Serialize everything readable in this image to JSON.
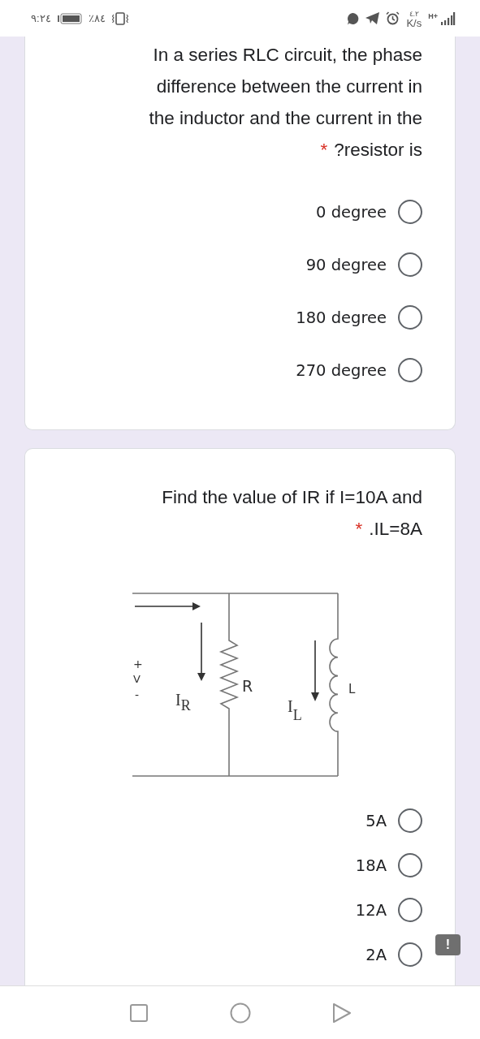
{
  "status_bar": {
    "time": "٩:٢٤",
    "battery": "٪٨٤",
    "speed_value": "٤.٢",
    "speed_unit": "K/s",
    "network": "H+"
  },
  "questions": [
    {
      "text_lines": [
        "In a series RLC circuit, the phase",
        "difference between the current in",
        "the inductor and the current in the",
        "?resistor is"
      ],
      "required": true,
      "required_mark": "*",
      "options": [
        {
          "label": "0 degree",
          "selected": false
        },
        {
          "label": "90 degree",
          "selected": false
        },
        {
          "label": "180 degree",
          "selected": false
        },
        {
          "label": "270 degree",
          "selected": false
        }
      ]
    },
    {
      "text_lines": [
        "Find the value of IR if I=10A and",
        ".IL=8A"
      ],
      "required": true,
      "required_mark": "*",
      "figure": {
        "kind": "circuit",
        "labels": {
          "plus": "+",
          "voltage": "V",
          "minus": "-",
          "resistor_current": "I",
          "resistor_current_sub": "R",
          "resistor": "R",
          "inductor_current": "I",
          "inductor_current_sub": "L",
          "inductor": "L"
        }
      },
      "options": [
        {
          "label": "5A",
          "selected": false
        },
        {
          "label": "18A",
          "selected": false
        },
        {
          "label": "12A",
          "selected": false
        },
        {
          "label": "2A",
          "selected": false
        }
      ]
    }
  ],
  "feedback_badge": "!"
}
